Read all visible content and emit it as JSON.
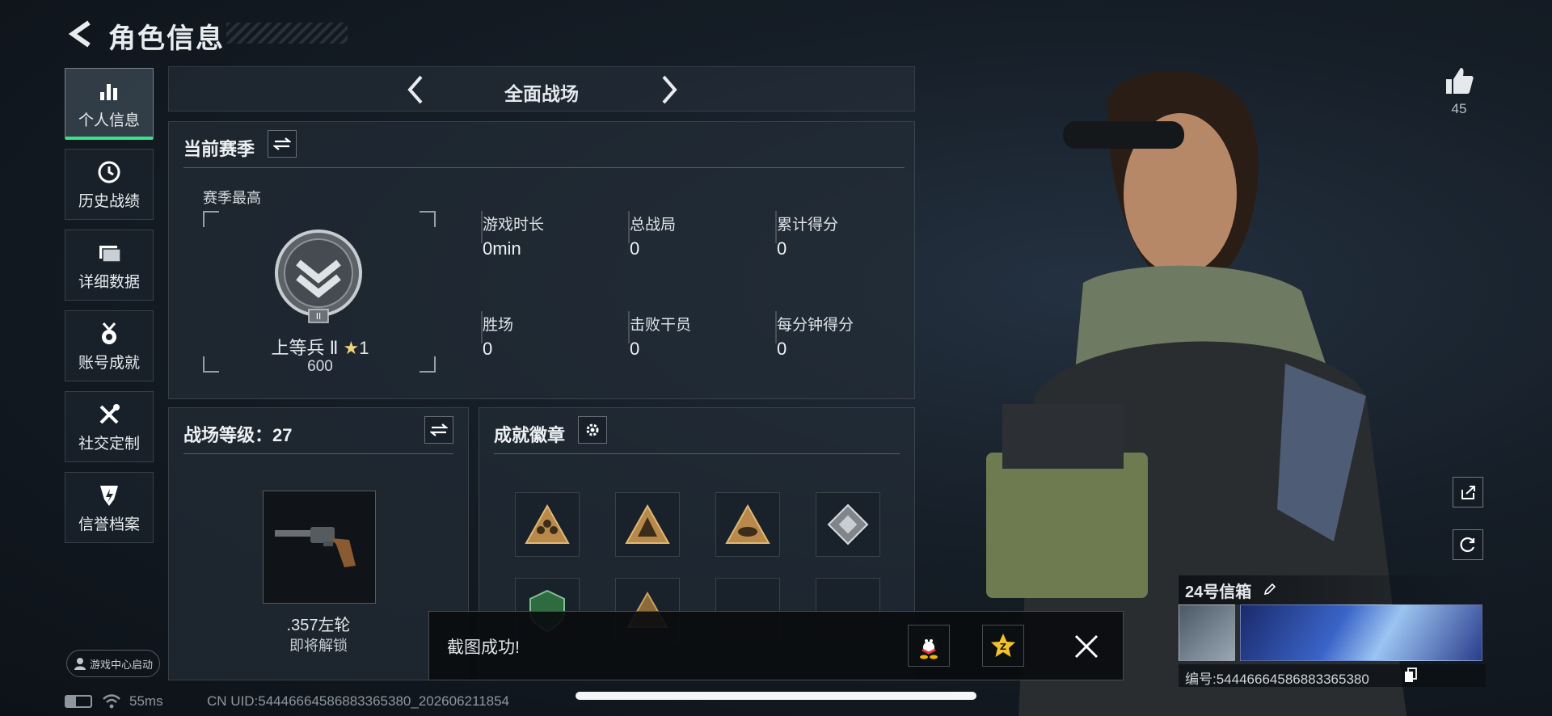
{
  "header": {
    "title": "角色信息"
  },
  "sidebar": {
    "items": [
      {
        "label": "个人信息",
        "icon": "bar-chart-icon",
        "active": true
      },
      {
        "label": "历史战绩",
        "icon": "history-icon",
        "active": false
      },
      {
        "label": "详细数据",
        "icon": "folder-icon",
        "active": false
      },
      {
        "label": "账号成就",
        "icon": "medal-icon",
        "active": false
      },
      {
        "label": "社交定制",
        "icon": "tools-icon",
        "active": false
      },
      {
        "label": "信誉档案",
        "icon": "shield-icon",
        "active": false
      }
    ],
    "launcher_label": "游戏中心启动"
  },
  "mode_tabs": {
    "current": "全面战场"
  },
  "season": {
    "title": "当前赛季",
    "best_label": "赛季最高",
    "rank_name": "上等兵 Ⅱ",
    "rank_stars": "1",
    "rank_points": "600",
    "rank_numeral": "II",
    "stats": [
      {
        "label": "游戏时长",
        "value": "0min"
      },
      {
        "label": "总战局",
        "value": "0"
      },
      {
        "label": "累计得分",
        "value": "0"
      },
      {
        "label": "胜场",
        "value": "0"
      },
      {
        "label": "击败干员",
        "value": "0"
      },
      {
        "label": "每分钟得分",
        "value": "0"
      }
    ]
  },
  "battle_level": {
    "title": "战场等级：27",
    "weapon_name": ".357左轮",
    "weapon_status": "即将解锁"
  },
  "achievements": {
    "title": "成就徽章"
  },
  "toast": {
    "message": "截图成功!"
  },
  "profile": {
    "likes": "45",
    "name_card_title": "24号信箱",
    "id_label": "编号:5444666458688336538​0"
  },
  "status_bar": {
    "ping": "55ms",
    "uid": "CN UID:5444666458688336538​0_202606211854"
  },
  "colors": {
    "accent_green": "#3ee08a",
    "gold": "#c9a35a"
  }
}
